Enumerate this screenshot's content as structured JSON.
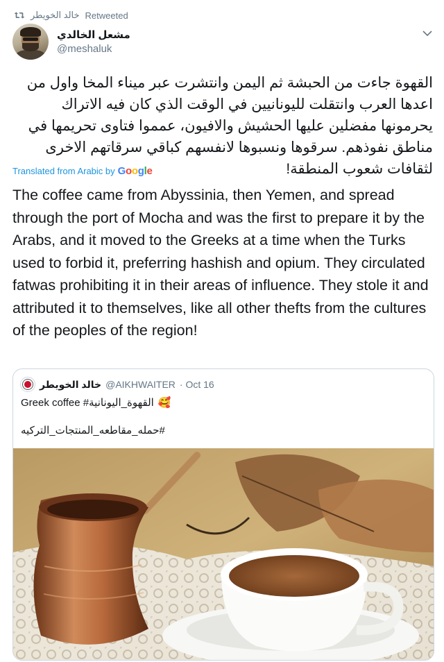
{
  "retweet": {
    "icon": "retweet-icon",
    "user": "خالد الخويطر",
    "label": "Retweeted"
  },
  "author": {
    "display_name": "مشعل الخالدي",
    "handle": "@meshaluk",
    "avatar_icon": "user-avatar"
  },
  "menu_icon": "chevron-down-icon",
  "tweet": {
    "arabic_text": "القهوة جاءت من الحبشة ثم اليمن وانتشرت عبر ميناء المخا واول من اعدها العرب وانتقلت لليونانيين في الوقت الذي كان فيه الاتراك يحرمونها مفضلين عليها الحشيش والافيون، عمموا فتاوى تحريمها في مناطق نفوذهم. سرقوها ونسبوها لانفسهم كباقي سرقاتهم الاخرى لثقافات شعوب المنطقة!",
    "translated_label": "Translated from Arabic by",
    "google_label": "Google",
    "english_text": "The coffee came from Abyssinia, then Yemen, and spread through the port of Mocha and was the first to prepare it by the Arabs, and it moved to the Greeks at a time when the Turks used to forbid it, preferring hashish and opium. They circulated fatwas prohibiting it in their areas of influence. They stole it and attributed it to themselves, like all other thefts from the cultures of the peoples of the region!"
  },
  "quoted": {
    "name": "خالد الخويطر",
    "handle": "@AIKHWAITER",
    "date": "· Oct 16",
    "line1_text": "Greek coffee #القهوة_اليونانية",
    "line1_emoji": "🥰",
    "line2_text": "#حمله_مقاطعه_المنتجات_التركيه",
    "image_icon": "coffee-photo"
  },
  "colors": {
    "link": "#1b95e0",
    "muted": "#657786",
    "text": "#14171a",
    "border": "#ccd6dd"
  }
}
